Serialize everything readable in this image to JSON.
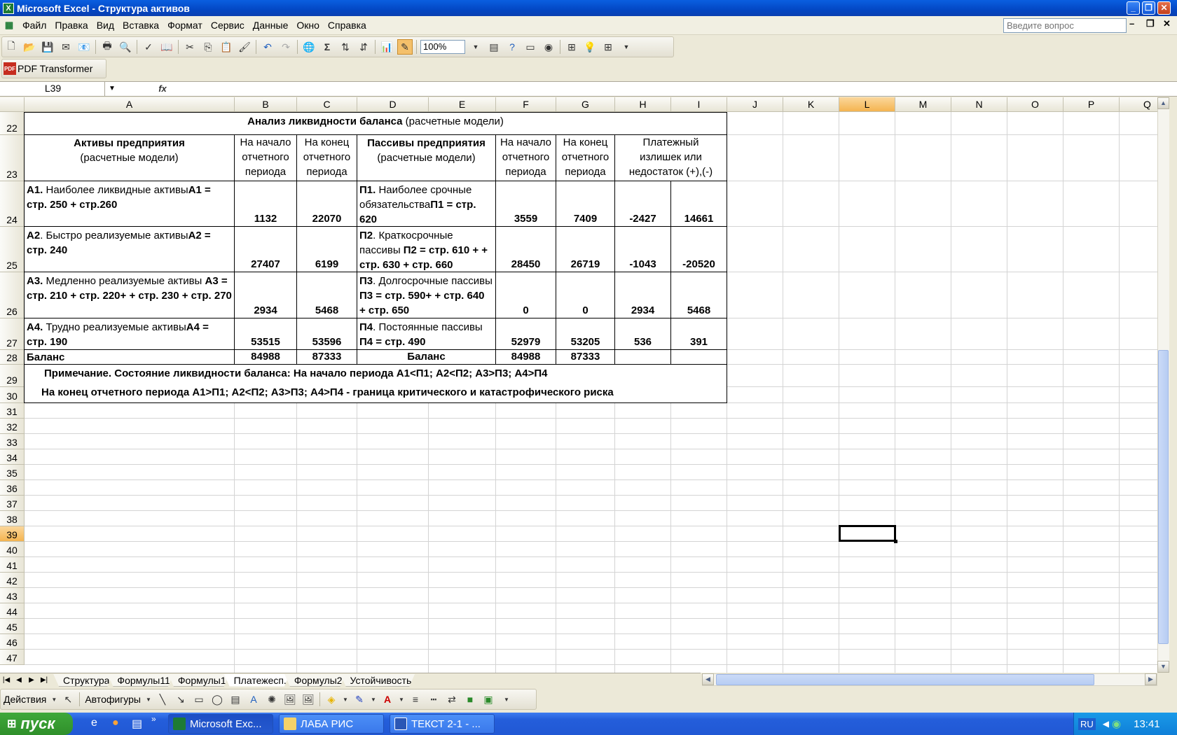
{
  "window": {
    "title": "Microsoft Excel - Структура активов",
    "icon": "excel-icon"
  },
  "menu": {
    "items": [
      "Файл",
      "Правка",
      "Вид",
      "Вставка",
      "Формат",
      "Сервис",
      "Данные",
      "Окно",
      "Справка"
    ],
    "ask_placeholder": "Введите вопрос"
  },
  "toolbar": {
    "zoom": "100%"
  },
  "pdf_toolbar": {
    "label": "PDF Transformer"
  },
  "formula": {
    "name_box": "L39",
    "fx": "fx",
    "value": ""
  },
  "columns": [
    "A",
    "B",
    "C",
    "D",
    "E",
    "F",
    "G",
    "H",
    "I",
    "J",
    "K",
    "L",
    "M",
    "N",
    "O",
    "P",
    "Q"
  ],
  "selected_column": "L",
  "rows": [
    "22",
    "23",
    "24",
    "25",
    "26",
    "27",
    "28",
    "29",
    "30",
    "31",
    "32",
    "33",
    "34",
    "35",
    "36",
    "37",
    "38",
    "39",
    "40",
    "41",
    "42",
    "43",
    "44",
    "45",
    "46",
    "47"
  ],
  "selected_row": "39",
  "table": {
    "title_bold": "Анализ ликвидности баланса",
    "title_rest": " (расчетные модели)",
    "header": {
      "assets_bold": "Активы  предприятия",
      "assets_sub": "(расчетные модели)",
      "start": "На начало отчетного периода",
      "end": "На конец отчетного периода",
      "liab_bold": "Пассивы предприятия",
      "liab_sub": "(расчетные модели)",
      "start2": "На начало отчетного периода",
      "end2": "На конец отчетного периода",
      "surplus": "Платежный излишек или недостаток (+),(-)"
    },
    "rows": [
      {
        "a_code": "А1.",
        "a_text": " Наиболее ликвидные активы",
        "a_formula": "А1 = стр. 250 + стр.260",
        "b": "1132",
        "c": "22070",
        "d_code": "П1.",
        "d_text": " Наиболее срочные обязательства",
        "d_formula": "П1 = стр. 620",
        "f": "3559",
        "g": "7409",
        "h": "-2427",
        "i": "14661"
      },
      {
        "a_code": "А2",
        "a_text": ". Быстро реализуемые активы",
        "a_formula": "А2 = стр. 240",
        "b": "27407",
        "c": "6199",
        "d_code": "П2",
        "d_text": ". Краткосрочные пассивы ",
        "d_formula": "П2 = стр. 610 + + стр. 630 + стр. 660",
        "f": "28450",
        "g": "26719",
        "h": "-1043",
        "i": "-20520"
      },
      {
        "a_code": "А3.",
        "a_text": " Медленно реализуемые активы ",
        "a_formula": "А3 = стр. 210 + стр. 220+ + стр. 230 + стр. 270",
        "b": "2934",
        "c": "5468",
        "d_code": "П3",
        "d_text": ". Долгосрочные пассивы ",
        "d_formula": "П3 = стр. 590+ + стр. 640 + стр. 650",
        "f": "0",
        "g": "0",
        "h": "2934",
        "i": "5468"
      },
      {
        "a_code": "А4.",
        "a_text": " Трудно реализуемые активы",
        "a_formula": "А4 = стр. 190",
        "b": "53515",
        "c": "53596",
        "d_code": "П4",
        "d_text": ". Постоянные пассивы ",
        "d_formula": "П4 = стр. 490",
        "f": "52979",
        "g": "53205",
        "h": "536",
        "i": "391"
      }
    ],
    "balance": {
      "a": "Баланс",
      "b": "84988",
      "c": "87333",
      "d": "Баланс",
      "f": "84988",
      "g": "87333"
    },
    "note1": "Примечание. Состояние ликвидности баланса: На начало периода А1<П1; А2<П2; А3>П3; А4>П4",
    "note2": "На конец отчетного периода А1>П1; А2<П2; А3>П3; А4>П4 -  граница критического и катастрофического риска"
  },
  "sheets": [
    "Структура",
    "Формулы11",
    "Формулы1",
    "Платежесп.",
    "Формулы2",
    "Устойчивость"
  ],
  "active_sheet": "Платежесп.",
  "drawing": {
    "actions": "Действия",
    "autoshapes": "Автофигуры"
  },
  "taskbar": {
    "start": "пуск",
    "tasks": [
      "Microsoft Exc...",
      "ЛАБА РИС",
      "ТЕКСТ 2-1 - ..."
    ],
    "lang": "RU",
    "time": "13:41"
  }
}
